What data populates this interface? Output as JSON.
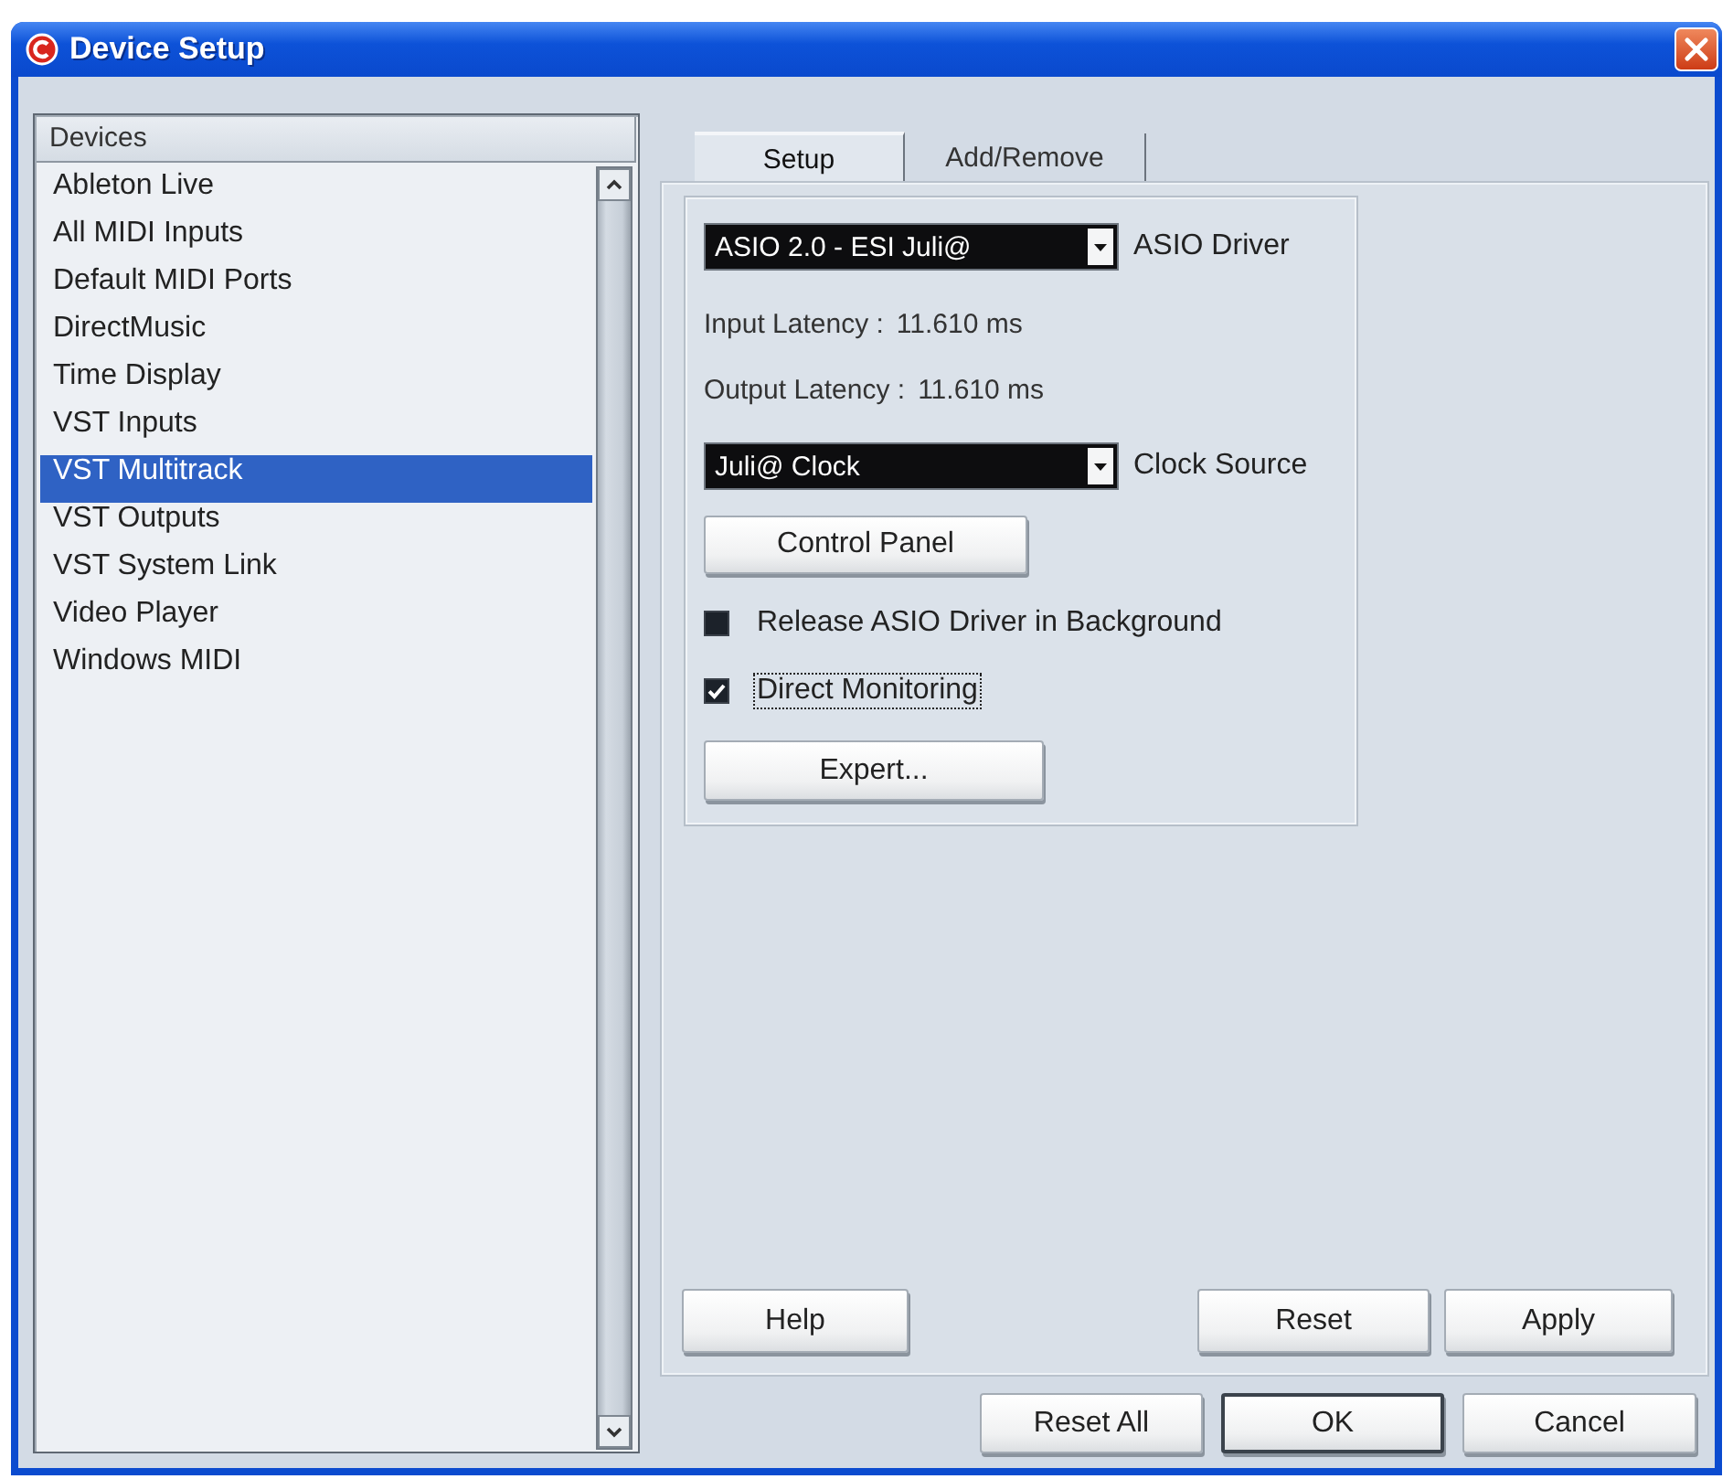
{
  "window": {
    "title": "Device Setup"
  },
  "devices": {
    "header": "Devices",
    "items": [
      {
        "label": "Ableton Live",
        "selected": false
      },
      {
        "label": "All MIDI Inputs",
        "selected": false
      },
      {
        "label": "Default MIDI Ports",
        "selected": false
      },
      {
        "label": "DirectMusic",
        "selected": false
      },
      {
        "label": "Time Display",
        "selected": false
      },
      {
        "label": "VST Inputs",
        "selected": false
      },
      {
        "label": "VST Multitrack",
        "selected": true
      },
      {
        "label": "VST Outputs",
        "selected": false
      },
      {
        "label": "VST System Link",
        "selected": false
      },
      {
        "label": "Video Player",
        "selected": false
      },
      {
        "label": "Windows MIDI",
        "selected": false
      }
    ]
  },
  "tabs": [
    {
      "label": "Setup",
      "selected": true
    },
    {
      "label": "Add/Remove",
      "selected": false
    }
  ],
  "setup": {
    "driver": {
      "value": "ASIO 2.0 - ESI Juli@",
      "label": "ASIO Driver"
    },
    "latency": [
      {
        "label": "Input Latency :",
        "value": "11.610 ms"
      },
      {
        "label": "Output Latency :",
        "value": "11.610 ms"
      }
    ],
    "clock": {
      "value": "Juli@ Clock",
      "label": "Clock Source"
    },
    "control_panel_button": "Control Panel",
    "options": [
      {
        "label": "Release ASIO Driver in Background",
        "checked": false,
        "focused": false
      },
      {
        "label": "Direct Monitoring",
        "checked": true,
        "focused": true
      }
    ],
    "expert_button": "Expert..."
  },
  "panel_buttons": [
    "Help",
    "Reset",
    "Apply"
  ],
  "dialog_buttons": [
    {
      "label": "Reset All",
      "default": false
    },
    {
      "label": "OK",
      "default": true
    },
    {
      "label": "Cancel",
      "default": false
    }
  ]
}
